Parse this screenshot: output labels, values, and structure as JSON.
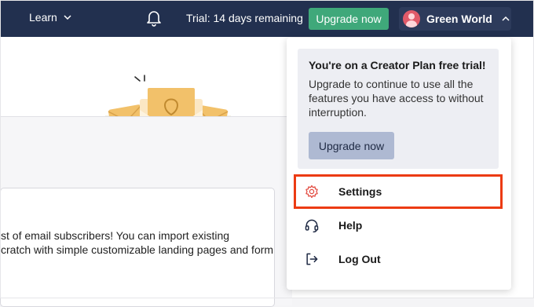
{
  "topbar": {
    "learn_label": "Learn",
    "trial_text": "Trial: 14 days remaining",
    "upgrade_label": "Upgrade now",
    "account_name": "Green World"
  },
  "page": {
    "line1": "st of email subscribers! You can import existing",
    "line2": "cratch with simple customizable landing pages and form"
  },
  "dropdown": {
    "promo_title": "You're on a Creator Plan free trial!",
    "promo_body": "Upgrade to continue to use all the features you have access to without interruption.",
    "promo_button": "Upgrade now",
    "items": [
      {
        "label": "Settings",
        "icon": "gear-icon"
      },
      {
        "label": "Help",
        "icon": "headset-icon"
      },
      {
        "label": "Log Out",
        "icon": "logout-icon"
      }
    ]
  },
  "colors": {
    "topbar_bg": "#22304f",
    "upgrade_green": "#3fa87a",
    "settings_icon": "#e2483d",
    "highlight": "#ec3b13",
    "promo_button": "#aeb9d2"
  }
}
